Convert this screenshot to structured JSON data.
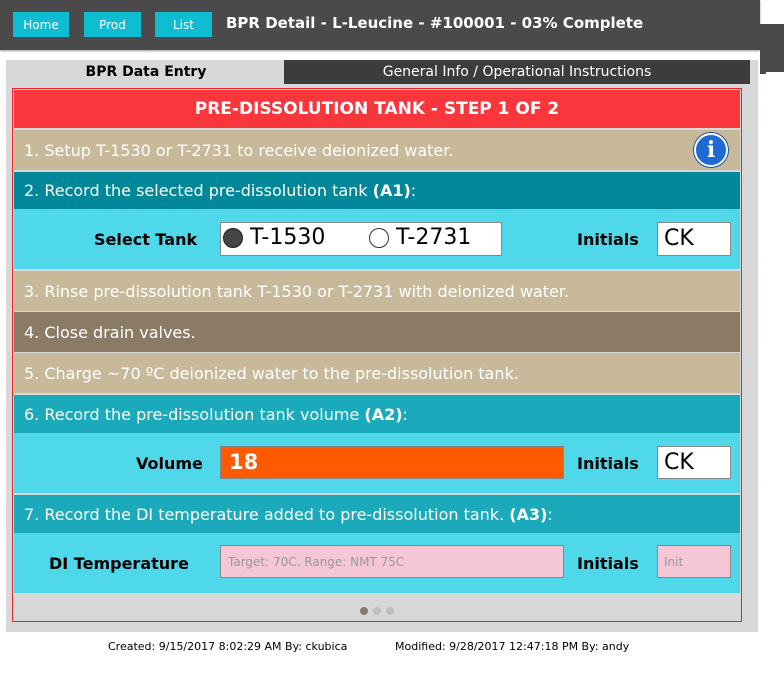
{
  "nav": {
    "home": "Home",
    "prod": "Prod",
    "list": "List"
  },
  "title": "BPR Detail - L-Leucine - #100001 - 03% Complete",
  "tabs": {
    "active": "BPR Data Entry",
    "inactive": "General Info / Operational Instructions"
  },
  "header": "PRE-DISSOLUTION TANK - STEP 1 OF 2",
  "steps": {
    "s1": "1. Setup T-1530 or T-2731 to receive deionized water.",
    "s2_text": "2. Record the selected pre-dissolution tank ",
    "s2_code": "(A1)",
    "s2_colon": ":",
    "s3": "3. Rinse pre-dissolution tank T-1530 or T-2731 with deionized water.",
    "s4": "4. Close drain valves.",
    "s5": "5. Charge ~70 ºC deionized water to the pre-dissolution tank.",
    "s6_text": "6. Record the pre-dissolution tank volume ",
    "s6_code": "(A2)",
    "s6_colon": ":",
    "s7_text": "7. Record the DI temperature added to pre-dissolution tank. ",
    "s7_code": "(A3)",
    "s7_colon": ":"
  },
  "fields": {
    "select_tank_label": "Select Tank",
    "tank_option_1": "T-1530",
    "tank_option_2": "T-2731",
    "initials_label": "Initials",
    "initials_1": "CK",
    "volume_label": "Volume",
    "volume_value": "18",
    "initials_2": "CK",
    "di_temp_label": "DI Temperature",
    "di_temp_placeholder": "Target: 70C. Range: NMT 75C",
    "initials_3_placeholder": "Init"
  },
  "info_icon": "i",
  "footer": {
    "created": "Created: 9/15/2017 8:02:29 AM By: ckubica",
    "modified": "Modified: 9/28/2017 12:47:18 PM By: andy"
  },
  "colors": {
    "accent": "#0fbdd2",
    "header_red": "#f8363c",
    "volume_orange": "#ff5a00",
    "temp_pink": "#f5c6d6"
  }
}
